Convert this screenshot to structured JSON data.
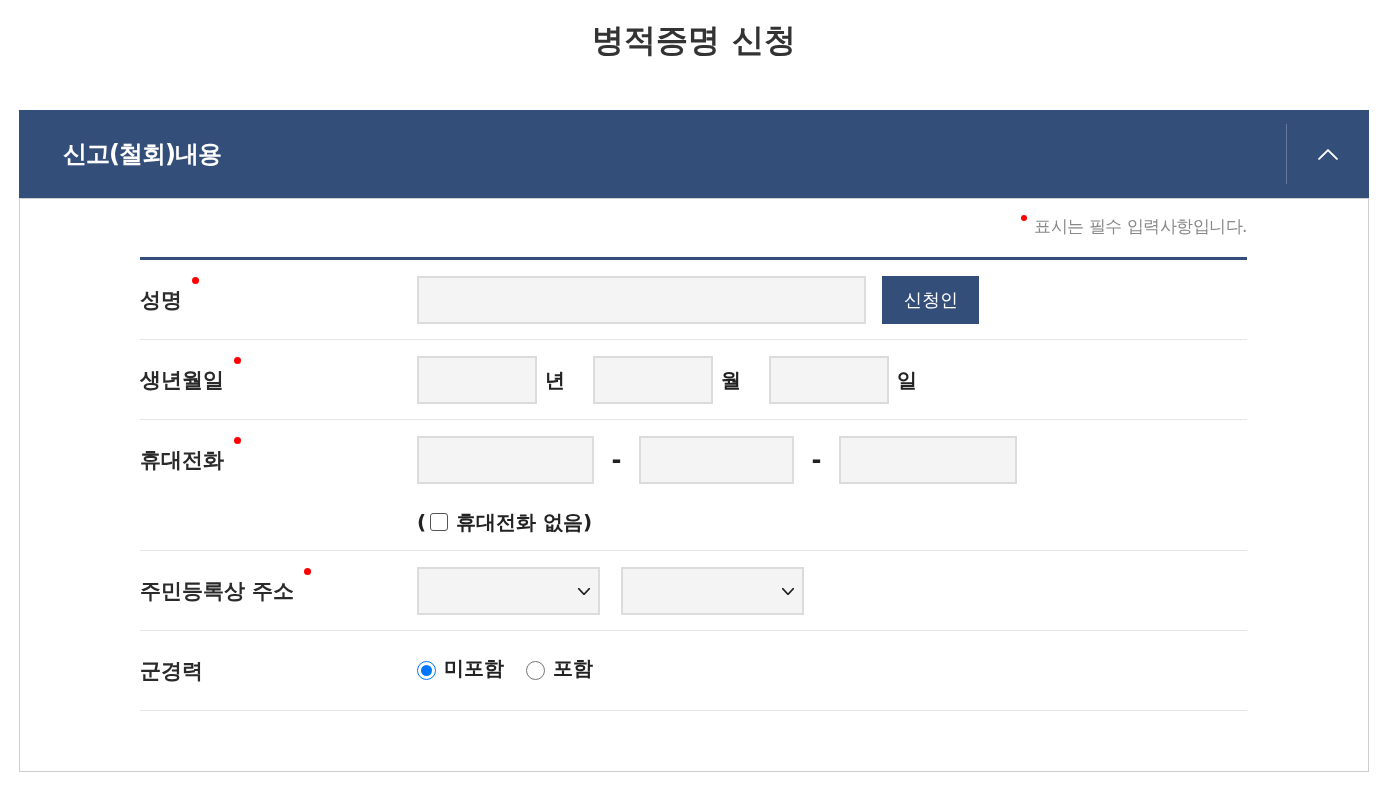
{
  "page_title": "병적증명 신청",
  "section": {
    "title": "신고(철회)내용",
    "expanded": true
  },
  "required_note": "표시는 필수 입력사항입니다.",
  "fields": [
    {
      "kind": "name",
      "label": "성명",
      "required": true,
      "button": "신청인"
    },
    {
      "kind": "date",
      "label": "생년월일",
      "required": true,
      "units": [
        "년",
        "월",
        "일"
      ]
    },
    {
      "kind": "phone",
      "label": "휴대전화",
      "required": true,
      "separators": [
        "-",
        "-"
      ],
      "checkbox": {
        "prefix": "(",
        "label": "휴대전화 없음)",
        "checked": false
      }
    },
    {
      "kind": "address",
      "label": "주민등록상 주소",
      "required": true,
      "dropdowns": [
        {
          "expanded": false
        },
        {
          "expanded": false
        }
      ]
    },
    {
      "kind": "radio",
      "label": "군경력",
      "required": false,
      "options": [
        {
          "label": "미포함",
          "selected": true
        },
        {
          "label": "포함",
          "selected": false
        }
      ]
    }
  ]
}
